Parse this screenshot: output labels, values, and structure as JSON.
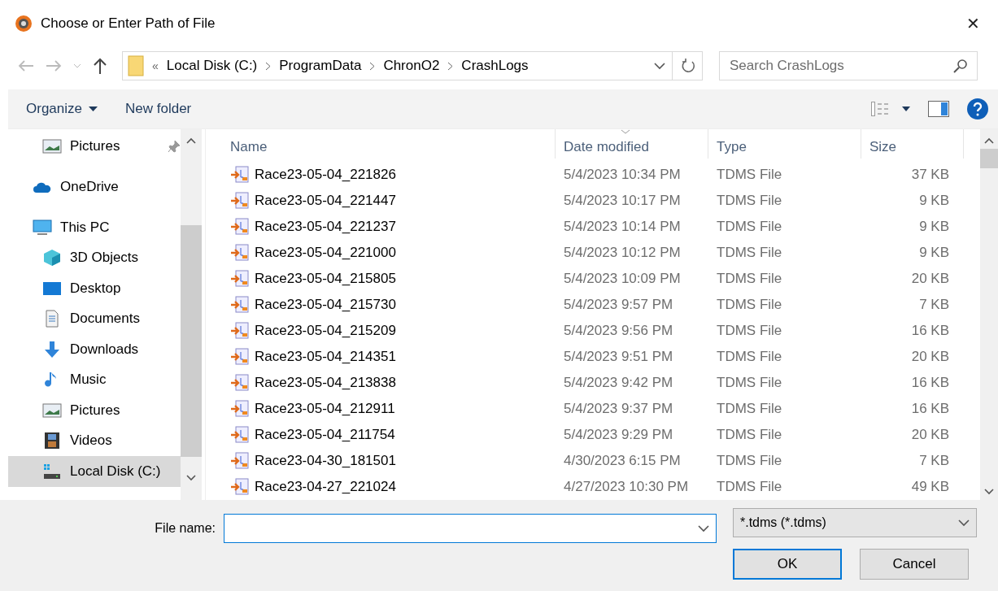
{
  "window": {
    "title": "Choose or Enter Path of File",
    "close": "✕"
  },
  "breadcrumb": {
    "overflow": "«",
    "items": [
      "Local Disk (C:)",
      "ProgramData",
      "ChronO2",
      "CrashLogs"
    ]
  },
  "search": {
    "placeholder": "Search CrashLogs"
  },
  "toolbar": {
    "organize": "Organize",
    "new_folder": "New folder"
  },
  "sidebar": {
    "items": [
      {
        "label": "Pictures",
        "kind": "pictures",
        "indent": true,
        "pinned": true,
        "selected": false
      },
      {
        "label": "OneDrive",
        "kind": "cloud",
        "indent": false,
        "pinned": false,
        "selected": false
      },
      {
        "label": "This PC",
        "kind": "pc",
        "indent": false,
        "pinned": false,
        "selected": false
      },
      {
        "label": "3D Objects",
        "kind": "cube",
        "indent": true,
        "pinned": false,
        "selected": false
      },
      {
        "label": "Desktop",
        "kind": "desktop",
        "indent": true,
        "pinned": false,
        "selected": false
      },
      {
        "label": "Documents",
        "kind": "document",
        "indent": true,
        "pinned": false,
        "selected": false
      },
      {
        "label": "Downloads",
        "kind": "download",
        "indent": true,
        "pinned": false,
        "selected": false
      },
      {
        "label": "Music",
        "kind": "music",
        "indent": true,
        "pinned": false,
        "selected": false
      },
      {
        "label": "Pictures",
        "kind": "pictures",
        "indent": true,
        "pinned": false,
        "selected": false
      },
      {
        "label": "Videos",
        "kind": "video",
        "indent": true,
        "pinned": false,
        "selected": false
      },
      {
        "label": "Local Disk (C:)",
        "kind": "disk",
        "indent": true,
        "pinned": false,
        "selected": true
      }
    ]
  },
  "table": {
    "columns": [
      "Name",
      "Date modified",
      "Type",
      "Size"
    ],
    "rows": [
      {
        "name": "Race23-05-04_221826",
        "date": "5/4/2023 10:34 PM",
        "type": "TDMS File",
        "size": "37 KB"
      },
      {
        "name": "Race23-05-04_221447",
        "date": "5/4/2023 10:17 PM",
        "type": "TDMS File",
        "size": "9 KB"
      },
      {
        "name": "Race23-05-04_221237",
        "date": "5/4/2023 10:14 PM",
        "type": "TDMS File",
        "size": "9 KB"
      },
      {
        "name": "Race23-05-04_221000",
        "date": "5/4/2023 10:12 PM",
        "type": "TDMS File",
        "size": "9 KB"
      },
      {
        "name": "Race23-05-04_215805",
        "date": "5/4/2023 10:09 PM",
        "type": "TDMS File",
        "size": "20 KB"
      },
      {
        "name": "Race23-05-04_215730",
        "date": "5/4/2023 9:57 PM",
        "type": "TDMS File",
        "size": "7 KB"
      },
      {
        "name": "Race23-05-04_215209",
        "date": "5/4/2023 9:56 PM",
        "type": "TDMS File",
        "size": "16 KB"
      },
      {
        "name": "Race23-05-04_214351",
        "date": "5/4/2023 9:51 PM",
        "type": "TDMS File",
        "size": "20 KB"
      },
      {
        "name": "Race23-05-04_213838",
        "date": "5/4/2023 9:42 PM",
        "type": "TDMS File",
        "size": "16 KB"
      },
      {
        "name": "Race23-05-04_212911",
        "date": "5/4/2023 9:37 PM",
        "type": "TDMS File",
        "size": "16 KB"
      },
      {
        "name": "Race23-05-04_211754",
        "date": "5/4/2023 9:29 PM",
        "type": "TDMS File",
        "size": "20 KB"
      },
      {
        "name": "Race23-04-30_181501",
        "date": "4/30/2023 6:15 PM",
        "type": "TDMS File",
        "size": "7 KB"
      },
      {
        "name": "Race23-04-27_221024",
        "date": "4/27/2023 10:30 PM",
        "type": "TDMS File",
        "size": "49 KB"
      }
    ]
  },
  "footer": {
    "file_name_label": "File name:",
    "filter": "*.tdms (*.tdms)",
    "ok": "OK",
    "cancel": "Cancel"
  }
}
